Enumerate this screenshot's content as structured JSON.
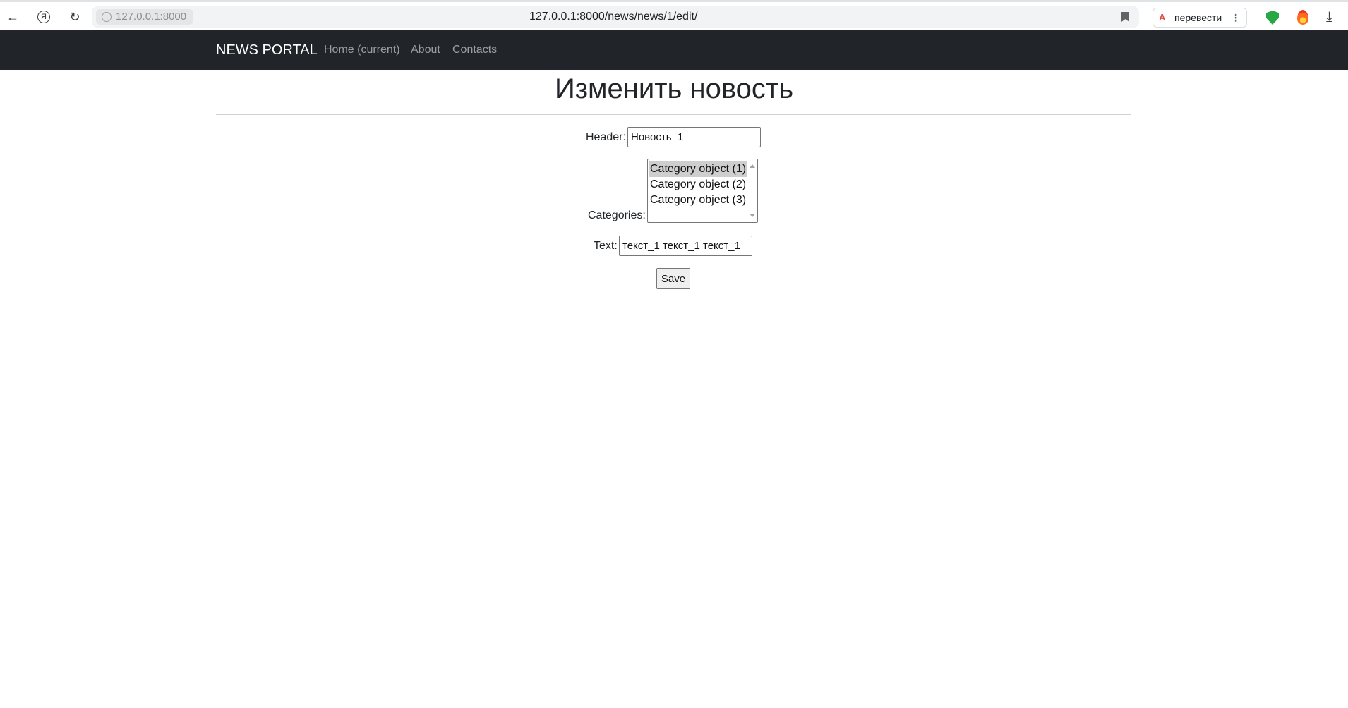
{
  "browser": {
    "site_chip": "127.0.0.1:8000",
    "url": "127.0.0.1:8000/news/news/1/edit/",
    "translate_label": "перевести",
    "translate_icon_text": "A",
    "menu_dots": "⋮",
    "back_icon": "←",
    "yandex_icon": "Я",
    "reload_icon": "↻",
    "download_icon": "⤓"
  },
  "navbar": {
    "brand": "NEWS PORTAL",
    "links": [
      {
        "label": "Home (current)"
      },
      {
        "label": "About"
      },
      {
        "label": "Contacts"
      }
    ]
  },
  "page": {
    "title": "Изменить новость"
  },
  "form": {
    "header_label": "Header:",
    "header_value": "Новость_1",
    "categories_label": "Categories:",
    "categories_options": [
      {
        "label": "Category object (1)",
        "selected": true
      },
      {
        "label": "Category object (2)",
        "selected": false
      },
      {
        "label": "Category object (3)",
        "selected": false
      }
    ],
    "text_label": "Text:",
    "text_value": "текст_1 текст_1 текст_1",
    "save_label": "Save"
  }
}
